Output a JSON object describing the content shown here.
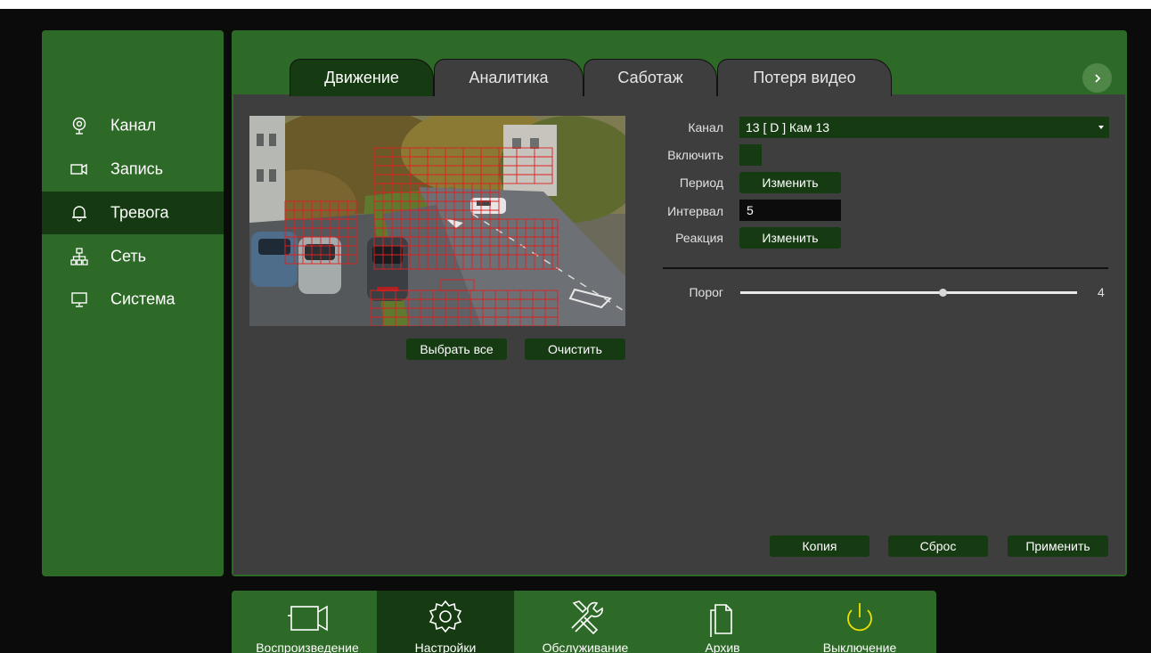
{
  "sidebar": {
    "items": [
      {
        "label": "Канал",
        "icon": "camera-lens-icon"
      },
      {
        "label": "Запись",
        "icon": "video-camera-icon"
      },
      {
        "label": "Тревога",
        "icon": "bell-icon",
        "active": true
      },
      {
        "label": "Сеть",
        "icon": "network-icon"
      },
      {
        "label": "Система",
        "icon": "monitor-icon"
      }
    ]
  },
  "tabs": [
    {
      "label": "Движение",
      "active": true
    },
    {
      "label": "Аналитика"
    },
    {
      "label": "Саботаж"
    },
    {
      "label": "Потеря видео"
    }
  ],
  "camera": {
    "select_all_label": "Выбрать все",
    "clear_label": "Очистить"
  },
  "settings": {
    "channel_label": "Канал",
    "channel_value": "13 [ D ] Кам 13",
    "enable_label": "Включить",
    "period_label": "Период",
    "period_button": "Изменить",
    "interval_label": "Интервал",
    "interval_value": "5",
    "reaction_label": "Реакция",
    "reaction_button": "Изменить",
    "threshold_label": "Порог",
    "threshold_value": "4",
    "threshold_fraction": 0.6
  },
  "actions": {
    "copy_label": "Копия",
    "reset_label": "Сброс",
    "apply_label": "Применить"
  },
  "dock": [
    {
      "label": "Воспроизведение",
      "icon": "video-camera-icon"
    },
    {
      "label": "Настройки",
      "icon": "gear-icon",
      "active": true
    },
    {
      "label": "Обслуживание",
      "icon": "tools-icon"
    },
    {
      "label": "Архив",
      "icon": "documents-icon"
    },
    {
      "label": "Выключение",
      "icon": "power-icon"
    }
  ],
  "colors": {
    "panel_green": "#2e6a27",
    "active_dark_green": "#163b12",
    "content_gray": "#3e3e3e",
    "grid_red": "#e02020",
    "power_yellow": "#f0e000"
  }
}
